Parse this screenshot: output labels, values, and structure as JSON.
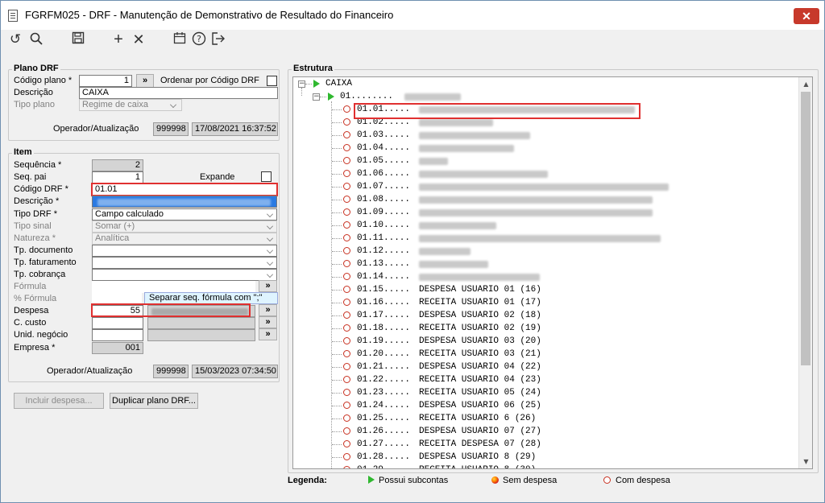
{
  "window": {
    "title": "FGRFM025 - DRF - Manutenção de Demonstrativo de Resultado do Financeiro",
    "close_label": "✕"
  },
  "toolbar": {
    "icons": [
      "undo-icon",
      "search-icon",
      "save-icon",
      "add-icon",
      "delete-icon",
      "calendar-icon",
      "help-icon",
      "exit-icon"
    ]
  },
  "plano": {
    "title": "Plano DRF",
    "codigo_label": "Código plano *",
    "codigo_value": "1",
    "lookup_label": "»",
    "ordenar_label": "Ordenar por Código DRF",
    "descricao_label": "Descrição",
    "descricao_value": "CAIXA",
    "tipo_label": "Tipo plano",
    "tipo_value": "Regime de caixa",
    "operador_label": "Operador/Atualização",
    "operador_value": "999998",
    "data_value": "17/08/2021 16:37:52"
  },
  "item": {
    "title": "Item",
    "sequencia_label": "Sequência *",
    "sequencia_value": "2",
    "seqpai_label": "Seq. pai",
    "seqpai_value": "1",
    "expande_label": "Expande",
    "codigo_label": "Código DRF *",
    "codigo_value": "01.01",
    "descricao_label": "Descrição *",
    "tipo_drf_label": "Tipo DRF *",
    "tipo_drf_value": "Campo calculado",
    "tipo_sinal_label": "Tipo sinal",
    "tipo_sinal_value": "Somar (+)",
    "natureza_label": "Natureza *",
    "natureza_value": "Analítica",
    "tp_documento_label": "Tp. documento",
    "tp_faturamento_label": "Tp. faturamento",
    "tp_cobranca_label": "Tp. cobrança",
    "formula_label": "Fórmula",
    "perc_formula_label": "% Fórmula",
    "tooltip": "Separar seq. fórmula com \";\"",
    "despesa_label": "Despesa",
    "despesa_value": "55",
    "ccusto_label": "C. custo",
    "unid_label": "Unid. negócio",
    "empresa_label": "Empresa *",
    "empresa_value": "001",
    "operador_label": "Operador/Atualização",
    "operador_value": "999998",
    "data_value": "15/03/2023 07:34:50",
    "lookup_label": "»"
  },
  "buttons": {
    "incluir": "Incluir despesa...",
    "duplicar": "Duplicar plano DRF..."
  },
  "estrutura": {
    "title": "Estrutura",
    "root": "CAIXA",
    "level1": "01........",
    "rows": [
      {
        "code": "01.01.....",
        "desc": ""
      },
      {
        "code": "01.02.....",
        "desc": ""
      },
      {
        "code": "01.03.....",
        "desc": ""
      },
      {
        "code": "01.04.....",
        "desc": ""
      },
      {
        "code": "01.05.....",
        "desc": ""
      },
      {
        "code": "01.06.....",
        "desc": ""
      },
      {
        "code": "01.07.....",
        "desc": ""
      },
      {
        "code": "01.08.....",
        "desc": ""
      },
      {
        "code": "01.09.....",
        "desc": ""
      },
      {
        "code": "01.10.....",
        "desc": ""
      },
      {
        "code": "01.11.....",
        "desc": ""
      },
      {
        "code": "01.12.....",
        "desc": ""
      },
      {
        "code": "01.13.....",
        "desc": ""
      },
      {
        "code": "01.14.....",
        "desc": ""
      },
      {
        "code": "01.15.....",
        "desc": "DESPESA USUARIO 01 (16)"
      },
      {
        "code": "01.16.....",
        "desc": "RECEITA USUARIO 01 (17)"
      },
      {
        "code": "01.17.....",
        "desc": "DESPESA USUARIO 02 (18)"
      },
      {
        "code": "01.18.....",
        "desc": "RECEITA USUARIO 02 (19)"
      },
      {
        "code": "01.19.....",
        "desc": "DESPESA USUARIO 03 (20)"
      },
      {
        "code": "01.20.....",
        "desc": "RECEITA USUARIO 03 (21)"
      },
      {
        "code": "01.21.....",
        "desc": "DESPESA USUARIO 04 (22)"
      },
      {
        "code": "01.22.....",
        "desc": "RECEITA USUARIO 04 (23)"
      },
      {
        "code": "01.23.....",
        "desc": "RECEITA USUARIO 05 (24)"
      },
      {
        "code": "01.24.....",
        "desc": "DESPESA USUARIO 06 (25)"
      },
      {
        "code": "01.25.....",
        "desc": "RECEITA USUARIO 6 (26)"
      },
      {
        "code": "01.26.....",
        "desc": "DESPESA USUARIO 07 (27)"
      },
      {
        "code": "01.27.....",
        "desc": "RECEITA DESPESA 07 (28)"
      },
      {
        "code": "01.28.....",
        "desc": "DESPESA USUARIO 8 (29)"
      },
      {
        "code": "01.29.....",
        "desc": "RECEITA USUARIO 8 (30)"
      }
    ]
  },
  "legenda": {
    "title": "Legenda:",
    "possui": "Possui subcontas",
    "sem": "Sem despesa",
    "com": "Com despesa"
  }
}
